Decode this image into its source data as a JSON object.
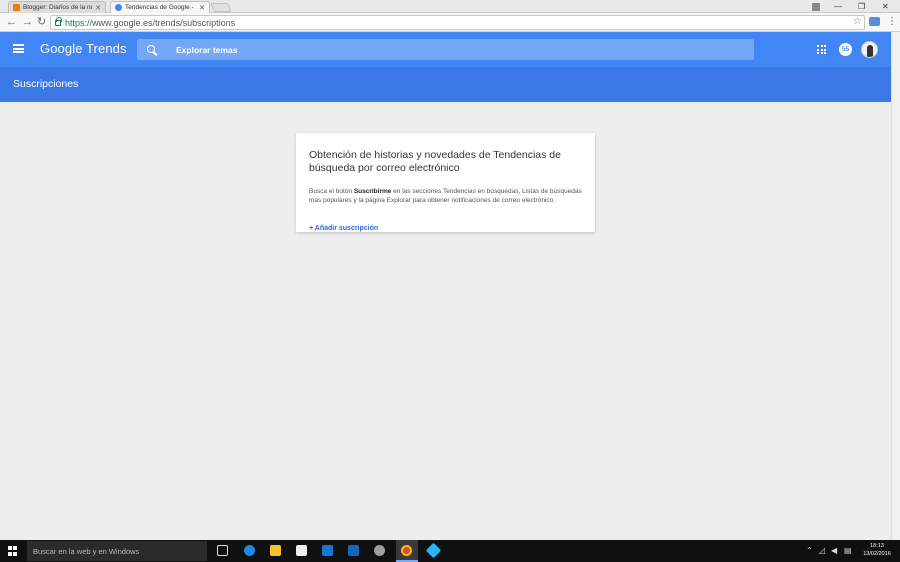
{
  "browser": {
    "tabs": [
      {
        "title": "Blogger: Diarios de la nub",
        "active": false,
        "favicon_color": "#f57c00"
      },
      {
        "title": "Tendencias de Google - S",
        "active": true,
        "favicon_color": "#4285f4"
      }
    ],
    "url_scheme": "https://",
    "url_rest": "www.google.es/trends/subscriptions",
    "window_controls": {
      "minimize": "—",
      "restore": "❐",
      "close": "✕"
    }
  },
  "app": {
    "logo": "Google Trends",
    "search_placeholder": "Explorar temas",
    "notification_count": "55",
    "accent": "#4285f4"
  },
  "page": {
    "title": "Suscripciones"
  },
  "card": {
    "title": "Obtención de historias y novedades de Tendencias de búsqueda por correo electrónico",
    "body_before": "Busca el botón ",
    "body_bold": "Suscribirme",
    "body_after": " en las secciones Tendencias en búsquedas, Listas de búsquedas más populares y la página Explorar para obtener notificaciones de correo electrónico.",
    "link": "+ Añadir suscripción"
  },
  "taskbar": {
    "search_placeholder": "Buscar en la web y en Windows",
    "time": "18:13",
    "date": "13/02/2016"
  }
}
